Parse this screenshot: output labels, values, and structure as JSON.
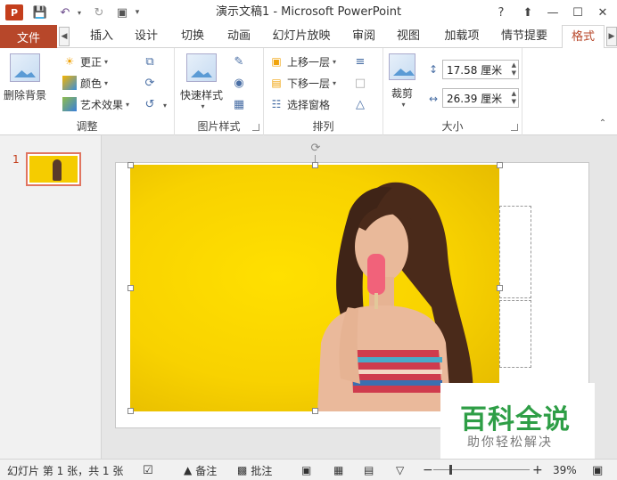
{
  "titlebar": {
    "title": "演示文稿1 - Microsoft PowerPoint",
    "app_badge": "P",
    "help": "?",
    "ribbon_display": "⬆",
    "minimize": "—",
    "maximize": "☐",
    "close": "✕"
  },
  "tabs": {
    "file": "文件",
    "items": [
      "插入",
      "设计",
      "切换",
      "动画",
      "幻灯片放映",
      "审阅",
      "视图",
      "加载项",
      "情节提要",
      "格式"
    ],
    "active": "格式"
  },
  "ribbon": {
    "adjust": {
      "label": "调整",
      "remove_background": "删除背景",
      "corrections": "更正",
      "color": "颜色",
      "artistic_effects": "艺术效果"
    },
    "picture_styles": {
      "label": "图片样式",
      "quick_styles": "快速样式"
    },
    "arrange": {
      "label": "排列",
      "bring_forward": "上移一层",
      "send_backward": "下移一层",
      "selection_pane": "选择窗格"
    },
    "size": {
      "label": "大小",
      "crop": "裁剪",
      "height": "17.58 厘米",
      "width": "26.39 厘米"
    }
  },
  "thumbnails": {
    "slide_number": "1"
  },
  "watermark": {
    "main": "百科全说",
    "sub": "助你轻松解决"
  },
  "statusbar": {
    "slide_info": "幻灯片 第 1 张，共 1 张",
    "notes": "备注",
    "comments": "批注",
    "zoom_minus": "−",
    "zoom_plus": "+",
    "zoom": "39%",
    "zoom_level": 0.39
  },
  "colors": {
    "accent": "#b7472a",
    "picture_bg": "#f8d200",
    "watermark_green": "#2e9e46"
  }
}
